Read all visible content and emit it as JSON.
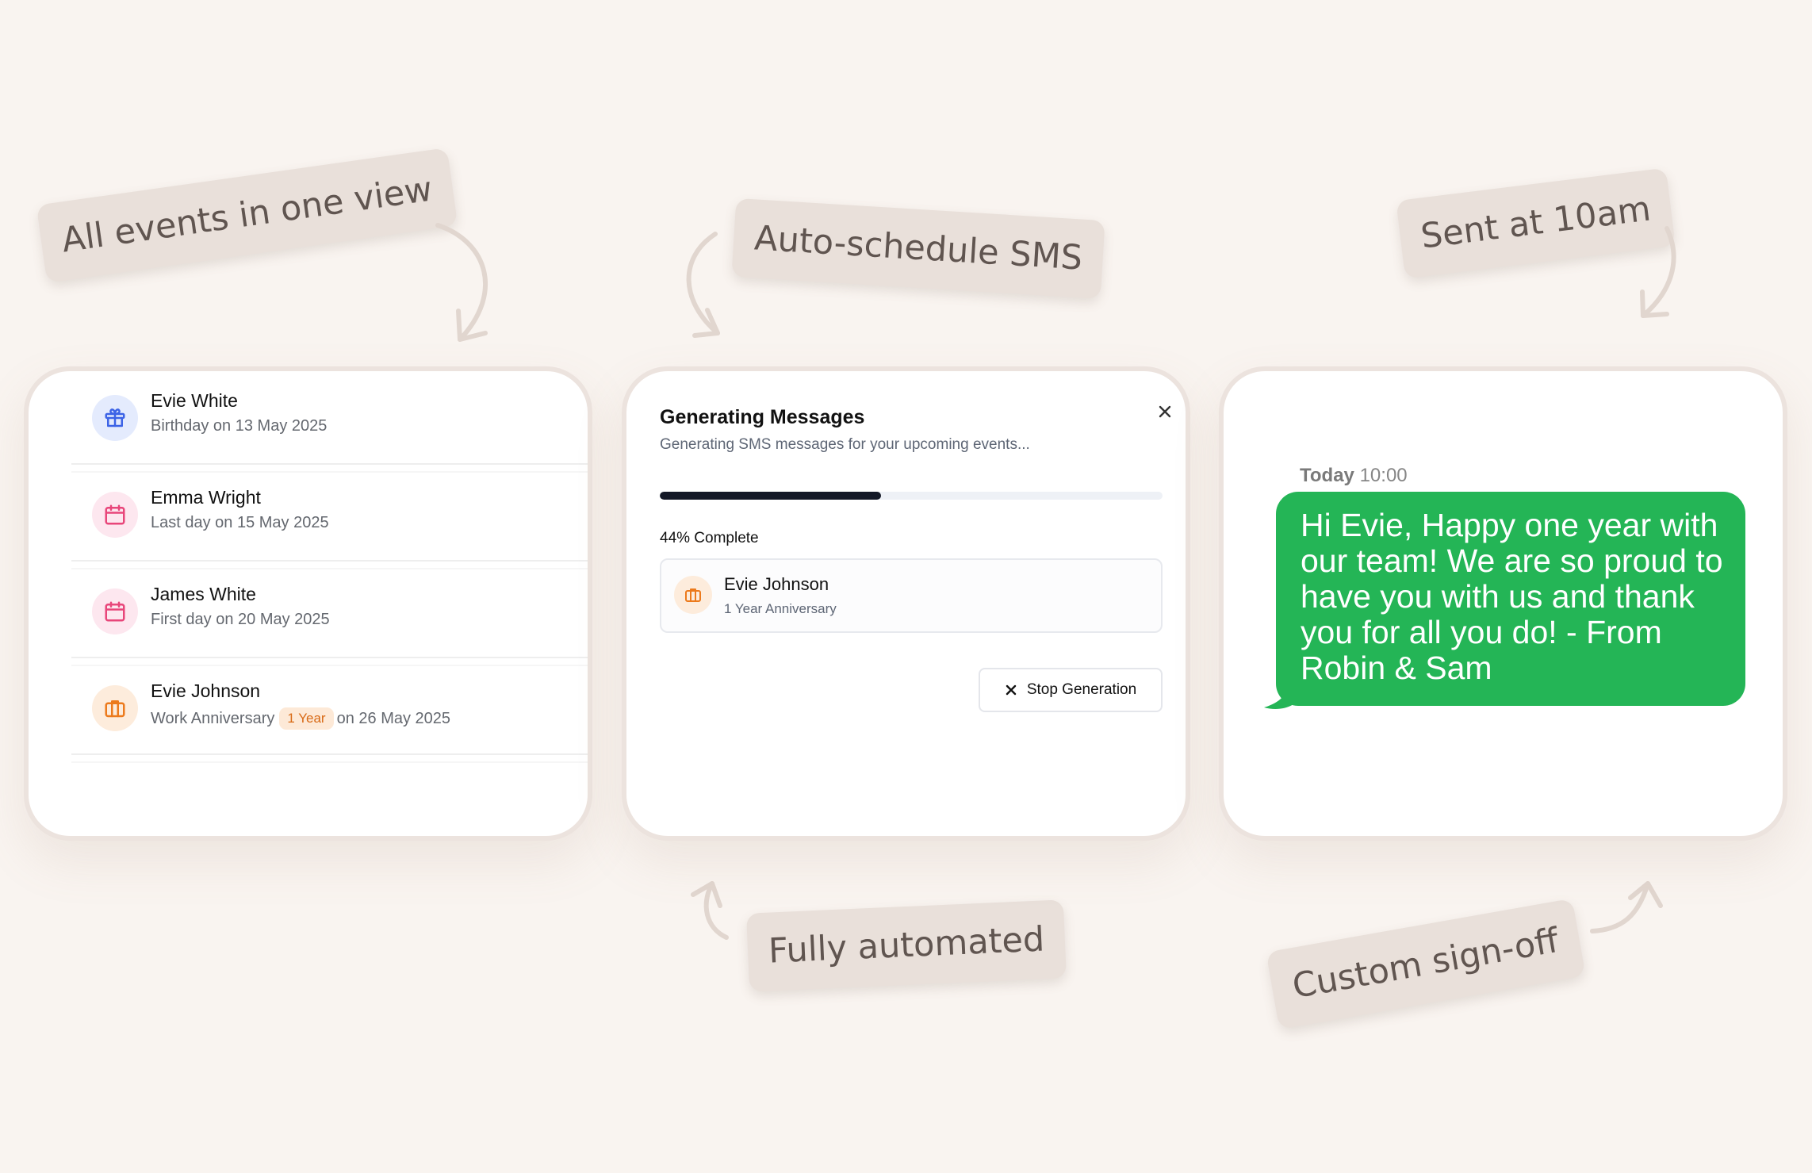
{
  "callouts": {
    "events_view": "All events in one view",
    "auto_schedule": "Auto-schedule SMS",
    "sent_at": "Sent at 10am",
    "fully_automated": "Fully automated",
    "custom_signoff": "Custom sign-off"
  },
  "events": [
    {
      "name": "Evie White",
      "description": "Birthday on 13 May 2025",
      "icon": "gift-icon"
    },
    {
      "name": "Emma Wright",
      "description": "Last day on 15 May 2025",
      "icon": "calendar-icon"
    },
    {
      "name": "James White",
      "description": "First day on 20 May 2025",
      "icon": "calendar-icon"
    },
    {
      "name": "Evie Johnson",
      "description_prefix": "Work Anniversary",
      "badge": "1 Year",
      "description_suffix": "on 26 May 2025",
      "icon": "briefcase-icon"
    }
  ],
  "generating": {
    "title": "Generating Messages",
    "subtitle": "Generating SMS messages for your upcoming events...",
    "progress_percent": 44,
    "progress_label": "44% Complete",
    "current_item": {
      "name": "Evie Johnson",
      "subtitle": "1 Year Anniversary",
      "icon": "briefcase-icon"
    },
    "stop_label": "Stop Generation"
  },
  "sms": {
    "day": "Today",
    "time": "10:00",
    "message": "Hi Evie, Happy one year with our team! We are so proud to have you with us and thank you for all you do! - From Robin & Sam"
  },
  "colors": {
    "background": "#f9f4f0",
    "callout_bg": "#e9e0da",
    "sms_green": "#24b556",
    "progress": "#141927",
    "birthday_icon": "#3c63e6",
    "calendar_icon": "#e8467a",
    "anniversary_icon": "#ec7a1c"
  }
}
